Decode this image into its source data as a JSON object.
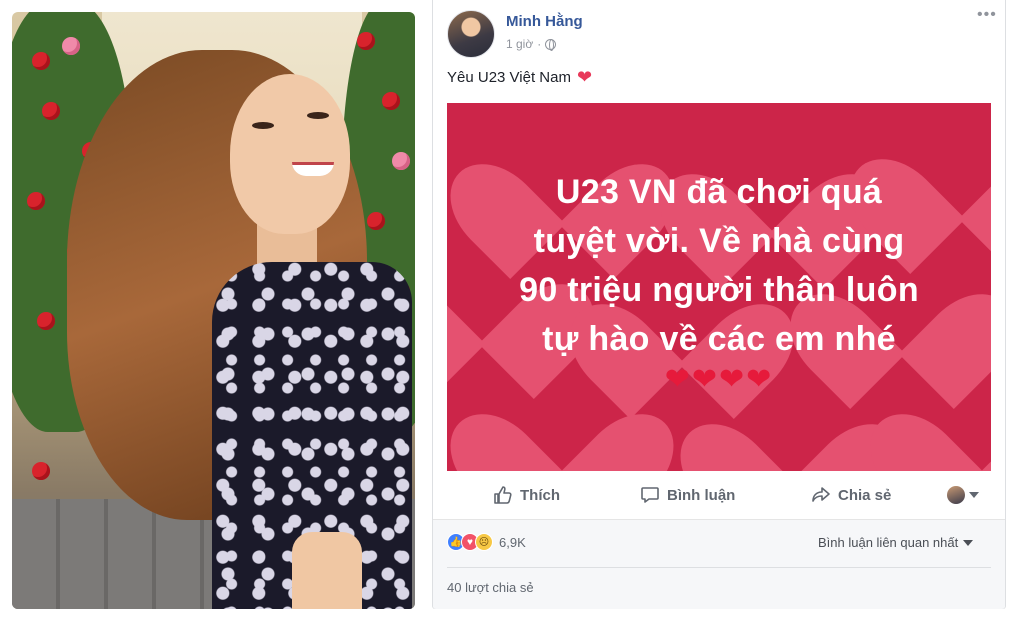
{
  "post": {
    "author": "Minh Hằng",
    "time": "1 giờ",
    "separator": "·",
    "more": "•••",
    "message": "Yêu U23 Việt Nam",
    "message_emoji": "❤",
    "background_text": [
      "U23 VN đã chơi quá",
      "tuyệt vời. Về nhà cùng",
      "90 triệu người thân luôn",
      "tự hào về các em nhé"
    ],
    "background_hearts": "❤❤❤❤",
    "background_color": "#cc2549"
  },
  "actions": {
    "like": "Thích",
    "comment": "Bình luận",
    "share": "Chia sẻ"
  },
  "stats": {
    "reaction_count": "6,9K",
    "sort_label": "Bình luận liên quan nhất",
    "shares": "40 lượt chia sẻ"
  },
  "icons": {
    "like": "thumbs-up-icon",
    "comment": "comment-bubble-icon",
    "share": "share-arrow-icon"
  },
  "colors": {
    "author_link": "#365899",
    "like_react": "#4080ff",
    "love_react": "#f25268",
    "sad_react": "#f7c845"
  }
}
